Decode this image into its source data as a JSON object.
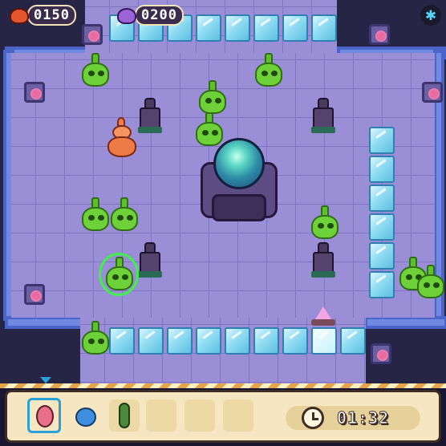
{
  "hud": {
    "red_count": "0150",
    "purple_count": "0200",
    "red_icon": "red-blob-icon",
    "purple_icon": "purple-blob-icon",
    "settings_icon": "gear-icon"
  },
  "bottom_bar": {
    "timer": "01:32",
    "clock_icon": "clock-icon",
    "slots": [
      {
        "icon": "red-egg-icon",
        "selected": true
      },
      {
        "icon": "blue-bulb-icon",
        "selected": false
      },
      {
        "icon": "green-cucumber-icon",
        "selected": false
      },
      {
        "icon": "",
        "selected": false
      },
      {
        "icon": "",
        "selected": false
      },
      {
        "icon": "",
        "selected": false
      }
    ]
  },
  "colors": {
    "floor": "#9a8fd6",
    "ice": "#8fdcf2",
    "slime": "#6fd13a",
    "accent": "#2aa0d8",
    "tray": "#f6e7c2"
  }
}
